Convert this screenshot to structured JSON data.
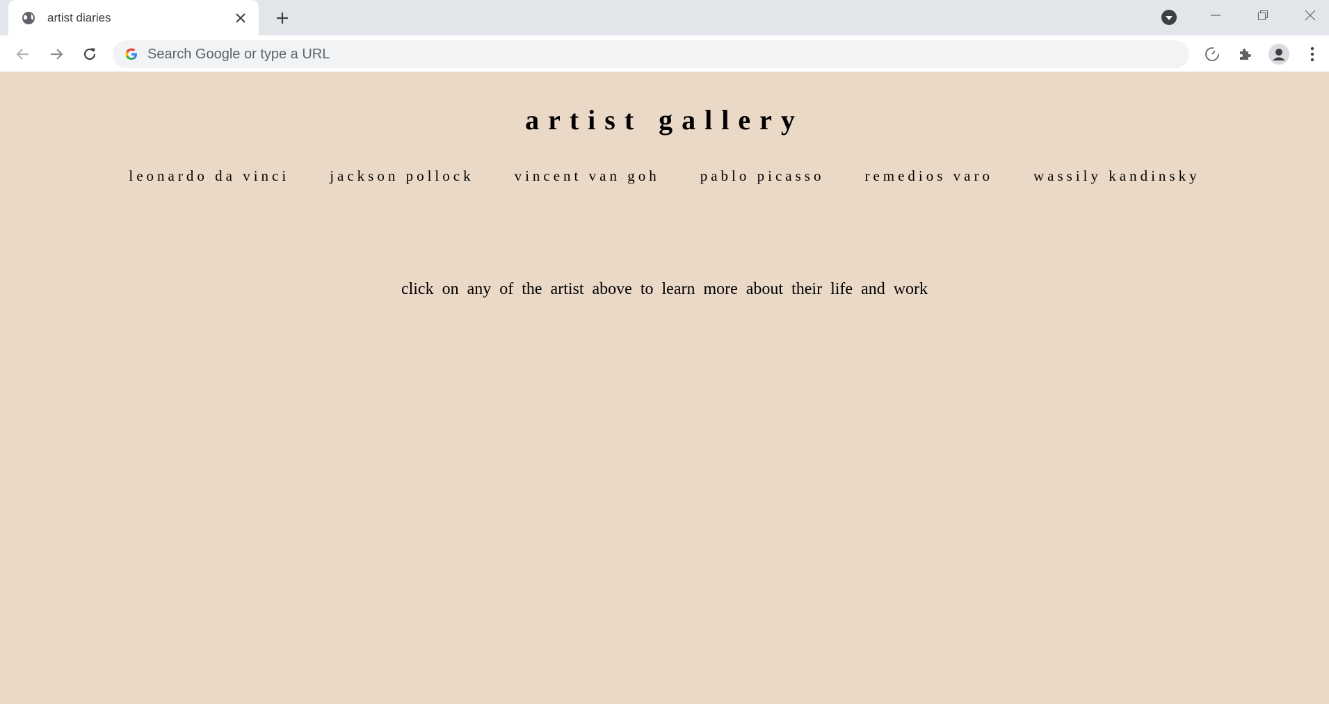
{
  "browser": {
    "tab": {
      "title": "artist diaries",
      "favicon": "globe-icon"
    },
    "omnibox": {
      "placeholder": "Search Google or type a URL"
    }
  },
  "page": {
    "title": "artist gallery",
    "artists": [
      "leonardo da vinci",
      "jackson pollock",
      "vincent van goh",
      "pablo picasso",
      "remedios varo",
      "wassily kandinsky"
    ],
    "intro": "click on any of the artist above to learn more about their life and work"
  },
  "colors": {
    "page_background": "#ead9c6",
    "tabstrip": "#e2e6eb",
    "text": "#000000"
  }
}
